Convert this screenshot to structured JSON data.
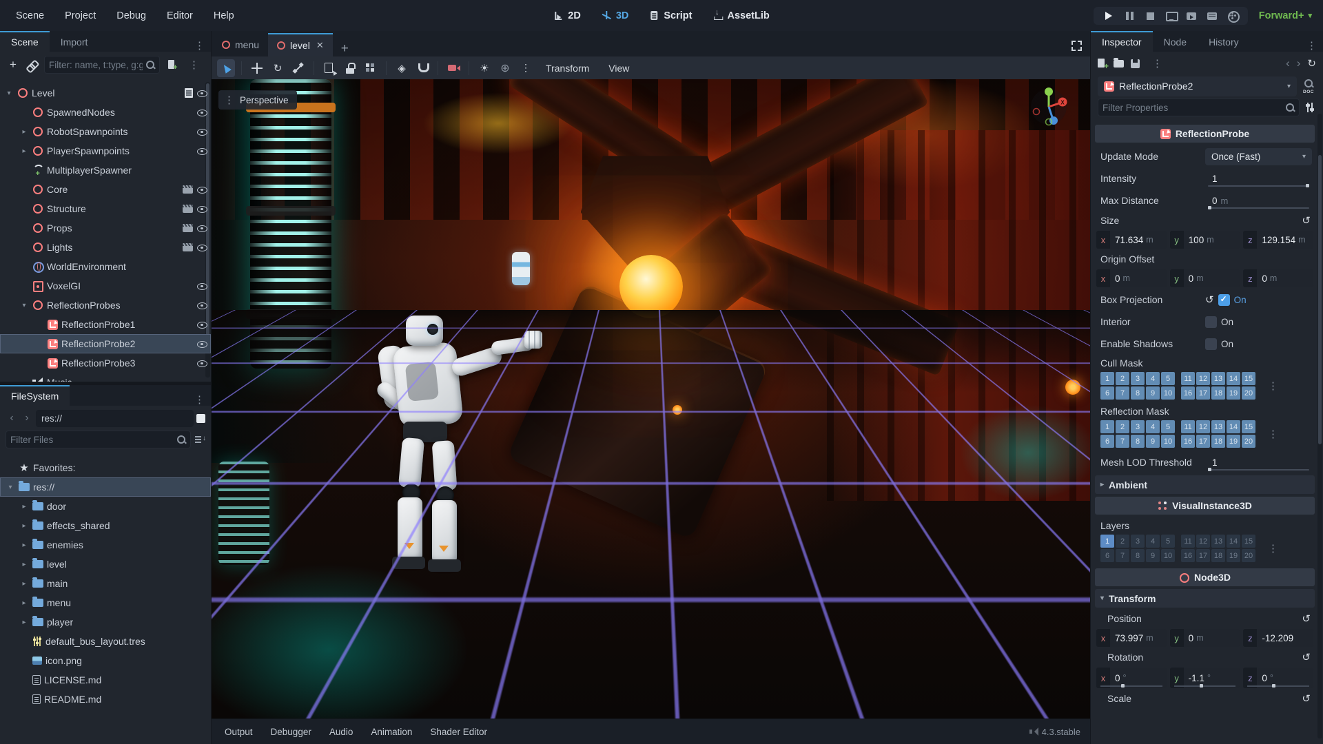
{
  "menubar": {
    "menus": [
      {
        "label": "Scene"
      },
      {
        "label": "Project"
      },
      {
        "label": "Debug"
      },
      {
        "label": "Editor"
      },
      {
        "label": "Help"
      }
    ],
    "switcher": [
      {
        "label": "2D",
        "icon": "2d-icon",
        "active": false
      },
      {
        "label": "3D",
        "icon": "3d-icon",
        "active": true
      },
      {
        "label": "Script",
        "icon": "script-icon",
        "active": false
      },
      {
        "label": "AssetLib",
        "icon": "assetlib-icon",
        "active": false
      }
    ],
    "playback": [
      {
        "icon": "play-icon"
      },
      {
        "icon": "pause-icon"
      },
      {
        "icon": "stop-icon"
      },
      {
        "icon": "remote-debug-icon"
      },
      {
        "icon": "play-scene-icon"
      },
      {
        "icon": "play-custom-scene-icon"
      },
      {
        "icon": "movie-maker-icon"
      }
    ],
    "renderer": {
      "label": "Forward+"
    }
  },
  "scene_dock": {
    "tabs": [
      {
        "label": "Scene",
        "active": true
      },
      {
        "label": "Import",
        "active": false
      }
    ],
    "filter_placeholder": "Filter: name, t:type, g:group",
    "tree": [
      {
        "label": "Level",
        "icon": "node3d",
        "depth": 0,
        "arrow": "down",
        "badges": [
          "script"
        ],
        "eye": true
      },
      {
        "label": "SpawnedNodes",
        "icon": "node3d",
        "depth": 1,
        "arrow": null,
        "badges": [],
        "eye": true
      },
      {
        "label": "RobotSpawnpoints",
        "icon": "node3d",
        "depth": 1,
        "arrow": "right",
        "badges": [],
        "eye": true
      },
      {
        "label": "PlayerSpawnpoints",
        "icon": "node3d",
        "depth": 1,
        "arrow": "right",
        "badges": [],
        "eye": true
      },
      {
        "label": "MultiplayerSpawner",
        "icon": "spawner",
        "depth": 1,
        "arrow": null,
        "badges": [],
        "eye": false
      },
      {
        "label": "Core",
        "icon": "node3d",
        "depth": 1,
        "arrow": null,
        "badges": [
          "instance"
        ],
        "eye": true
      },
      {
        "label": "Structure",
        "icon": "node3d",
        "depth": 1,
        "arrow": null,
        "badges": [
          "instance"
        ],
        "eye": true
      },
      {
        "label": "Props",
        "icon": "node3d",
        "depth": 1,
        "arrow": null,
        "badges": [
          "instance"
        ],
        "eye": true
      },
      {
        "label": "Lights",
        "icon": "node3d",
        "depth": 1,
        "arrow": null,
        "badges": [
          "instance"
        ],
        "eye": true
      },
      {
        "label": "WorldEnvironment",
        "icon": "world",
        "depth": 1,
        "arrow": null,
        "badges": [],
        "eye": false
      },
      {
        "label": "VoxelGI",
        "icon": "voxelgi",
        "depth": 1,
        "arrow": null,
        "badges": [],
        "eye": true
      },
      {
        "label": "ReflectionProbes",
        "icon": "node3d",
        "depth": 1,
        "arrow": "down",
        "badges": [],
        "eye": true
      },
      {
        "label": "ReflectionProbe1",
        "icon": "probe",
        "depth": 2,
        "arrow": null,
        "badges": [],
        "eye": true
      },
      {
        "label": "ReflectionProbe2",
        "icon": "probe",
        "depth": 2,
        "arrow": null,
        "badges": [],
        "eye": true,
        "selected": true
      },
      {
        "label": "ReflectionProbe3",
        "icon": "probe",
        "depth": 2,
        "arrow": null,
        "badges": [],
        "eye": true
      },
      {
        "label": "Music",
        "icon": "music",
        "depth": 1,
        "arrow": null,
        "badges": [],
        "eye": false
      }
    ]
  },
  "filesystem_dock": {
    "tab": "FileSystem",
    "path": "res://",
    "filter_placeholder": "Filter Files",
    "items": [
      {
        "label": "Favorites:",
        "icon": "star",
        "depth": 0,
        "arrow": null
      },
      {
        "label": "res://",
        "icon": "folder",
        "depth": 0,
        "arrow": "down",
        "selected": true
      },
      {
        "label": "door",
        "icon": "folder",
        "depth": 1,
        "arrow": "right"
      },
      {
        "label": "effects_shared",
        "icon": "folder",
        "depth": 1,
        "arrow": "right"
      },
      {
        "label": "enemies",
        "icon": "folder",
        "depth": 1,
        "arrow": "right"
      },
      {
        "label": "level",
        "icon": "folder",
        "depth": 1,
        "arrow": "right"
      },
      {
        "label": "main",
        "icon": "folder",
        "depth": 1,
        "arrow": "right"
      },
      {
        "label": "menu",
        "icon": "folder",
        "depth": 1,
        "arrow": "right"
      },
      {
        "label": "player",
        "icon": "folder",
        "depth": 1,
        "arrow": "right"
      },
      {
        "label": "default_bus_layout.tres",
        "icon": "audio-bus",
        "depth": 1,
        "arrow": null
      },
      {
        "label": "icon.png",
        "icon": "image",
        "depth": 1,
        "arrow": null
      },
      {
        "label": "LICENSE.md",
        "icon": "file",
        "depth": 1,
        "arrow": null
      },
      {
        "label": "README.md",
        "icon": "file",
        "depth": 1,
        "arrow": null
      }
    ]
  },
  "viewport": {
    "scene_tabs": [
      {
        "label": "menu",
        "active": false
      },
      {
        "label": "level",
        "active": true,
        "closable": true
      }
    ],
    "toolbar_icons": [
      {
        "icon": "select-tool-icon",
        "active": true
      },
      {
        "sep": true
      },
      {
        "icon": "move-tool-icon"
      },
      {
        "icon": "rotate-tool-icon"
      },
      {
        "icon": "scale-tool-icon"
      },
      {
        "sep": true
      },
      {
        "icon": "list-select-icon"
      },
      {
        "icon": "lock-icon"
      },
      {
        "icon": "group-icon"
      },
      {
        "sep": true
      },
      {
        "icon": "local-space-icon"
      },
      {
        "icon": "snap-icon"
      },
      {
        "sep": true
      },
      {
        "icon": "camera-preview-icon"
      },
      {
        "sep": true
      },
      {
        "icon": "sun-icon"
      },
      {
        "icon": "environment-icon"
      },
      {
        "icon": "more-options-icon"
      }
    ],
    "toolbar_menus": [
      {
        "label": "Transform"
      },
      {
        "label": "View"
      }
    ],
    "perspective_label": "Perspective"
  },
  "inspector": {
    "tabs": [
      {
        "label": "Inspector",
        "active": true
      },
      {
        "label": "Node",
        "active": false
      },
      {
        "label": "History",
        "active": false
      }
    ],
    "node_name": "ReflectionProbe2",
    "filter_placeholder": "Filter Properties",
    "probe_section_title": "ReflectionProbe",
    "props": {
      "update_mode": {
        "label": "Update Mode",
        "value": "Once (Fast)"
      },
      "intensity": {
        "label": "Intensity",
        "value": "1"
      },
      "max_distance": {
        "label": "Max Distance",
        "value": "0",
        "unit": "m"
      },
      "size": {
        "label": "Size",
        "x": "71.634",
        "y": "100",
        "z": "129.154",
        "unit": "m"
      },
      "origin_offset": {
        "label": "Origin Offset",
        "x": "0",
        "y": "0",
        "z": "0",
        "unit": "m"
      },
      "box_projection": {
        "label": "Box Projection",
        "value": "On",
        "checked": true
      },
      "interior": {
        "label": "Interior",
        "value": "On",
        "checked": false
      },
      "enable_shadows": {
        "label": "Enable Shadows",
        "value": "On",
        "checked": false
      },
      "cull_mask": {
        "label": "Cull Mask"
      },
      "reflection_mask": {
        "label": "Reflection Mask"
      },
      "mesh_lod": {
        "label": "Mesh LOD Threshold",
        "value": "1"
      }
    },
    "mask_rows": {
      "row1": [
        1,
        2,
        3,
        4,
        5,
        11,
        12,
        13,
        14,
        15
      ],
      "row2": [
        6,
        7,
        8,
        9,
        10,
        16,
        17,
        18,
        19,
        20
      ]
    },
    "cull_mask_enabled": "all",
    "reflection_mask_enabled": "all",
    "layers_enabled": [
      1
    ],
    "ambient_section": "Ambient",
    "visual_instance_section": "VisualInstance3D",
    "layers_label": "Layers",
    "node3d_section": "Node3D",
    "transform_section": {
      "title": "Transform",
      "position": {
        "label": "Position",
        "x": "73.997",
        "y": "0",
        "z": "-12.209",
        "unit": "m"
      },
      "rotation": {
        "label": "Rotation",
        "x": "0",
        "y": "-1.1",
        "z": "0",
        "unit": "°"
      },
      "scale": {
        "label": "Scale"
      }
    }
  },
  "bottom_bar": {
    "tabs": [
      {
        "label": "Output"
      },
      {
        "label": "Debugger"
      },
      {
        "label": "Audio"
      },
      {
        "label": "Animation"
      },
      {
        "label": "Shader Editor"
      }
    ],
    "version": "4.3.stable"
  }
}
